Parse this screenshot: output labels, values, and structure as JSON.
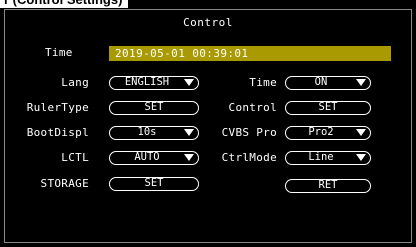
{
  "caption": "r (Control Settings)",
  "osd": {
    "title": "Control",
    "time_label": "Time",
    "time_value": "2019-05-01 00:39:01",
    "colors": {
      "highlight": "#a89a00",
      "background": "#000000",
      "text": "#ffffff"
    },
    "left": {
      "lang_label": "Lang",
      "lang_value": "ENGLISH",
      "rulertype_label": "RulerType",
      "rulertype_button": "SET",
      "bootdispl_label": "BootDispl",
      "bootdispl_value": "10s",
      "lctl_label": "LCTL",
      "lctl_value": "AUTO",
      "storage_label": "STORAGE",
      "storage_button": "SET"
    },
    "right": {
      "time_label": "Time",
      "time_value": "ON",
      "control_label": "Control",
      "control_button": "SET",
      "cvbs_label": "CVBS Pro",
      "cvbs_value": "Pro2",
      "ctrlmode_label": "CtrlMode",
      "ctrlmode_value": "Line",
      "ret_button": "RET"
    },
    "icons": {
      "dropdown": "triangle-down-icon"
    }
  }
}
